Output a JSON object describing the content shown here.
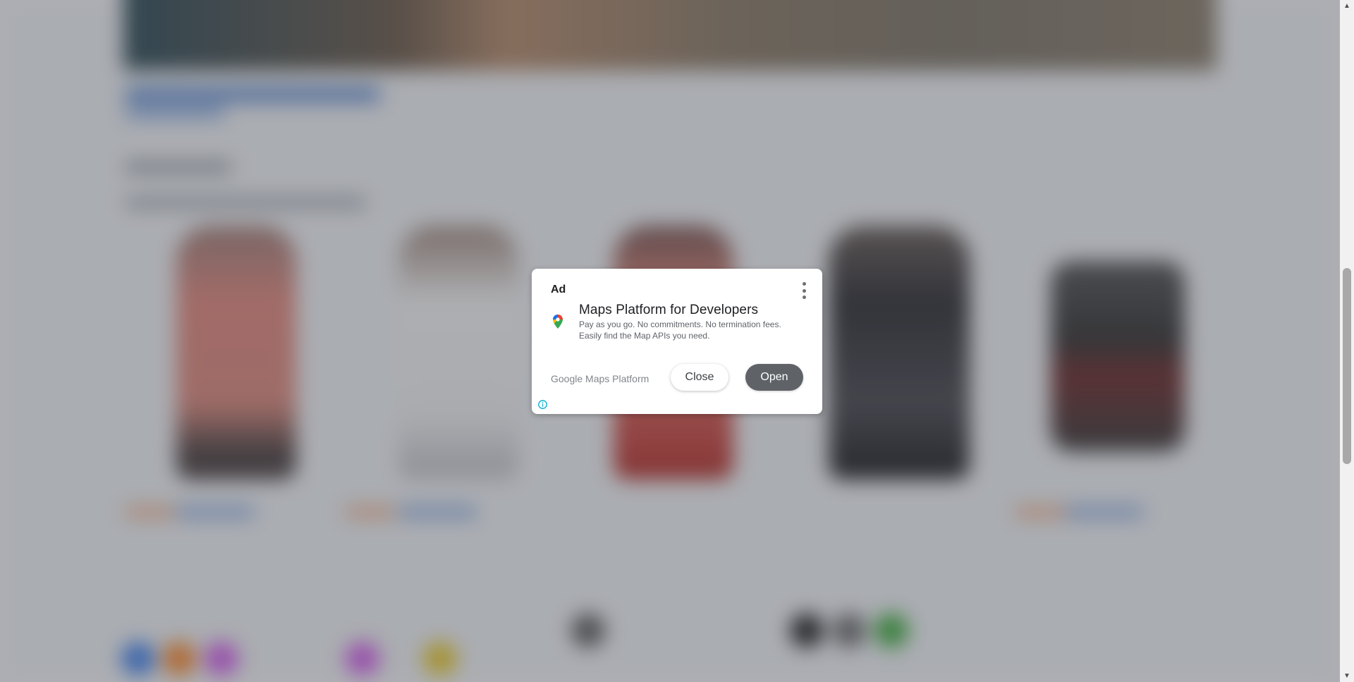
{
  "ad": {
    "label": "Ad",
    "title": "Maps Platform for Developers",
    "description_line1": "Pay as you go. No commitments. No termination fees.",
    "description_line2": "Easily find the Map APIs you need.",
    "advertiser": "Google Maps Platform",
    "close_label": "Close",
    "open_label": "Open",
    "icons": {
      "brand": "google-maps-pin-icon",
      "menu": "more-vertical-icon",
      "info": "info-icon"
    }
  },
  "scrollbar": {
    "up_arrow": "▲",
    "down_arrow": "▼"
  },
  "colors": {
    "overlay": "#3c4048",
    "open_button": "#5f6368",
    "info_icon": "#00aecd"
  }
}
